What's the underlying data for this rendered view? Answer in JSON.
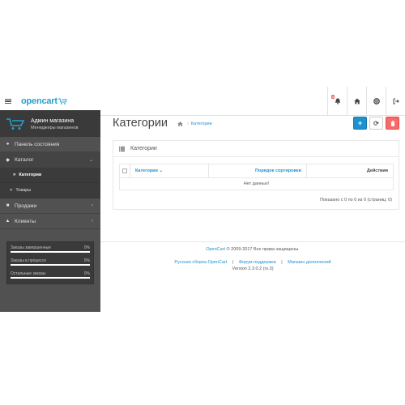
{
  "header": {
    "logo_text": "opencart",
    "notification_count": "5",
    "icons": [
      "menu-icon",
      "bell-icon",
      "home-icon",
      "life-ring-icon",
      "sign-out-icon"
    ]
  },
  "sidebar": {
    "profile_name": "Админ магазина",
    "profile_role": "Менеджеры магазинов",
    "items": [
      {
        "label": "Панель состояния",
        "icon": "dashboard-icon"
      },
      {
        "label": "Каталог",
        "icon": "tag-icon"
      },
      {
        "label": "Категории"
      },
      {
        "label": "Товары"
      },
      {
        "label": "Продажи",
        "icon": "cart-icon"
      },
      {
        "label": "Клиенты",
        "icon": "user-icon"
      }
    ],
    "stats": [
      {
        "label": "Заказы завершенные",
        "value": "0%"
      },
      {
        "label": "Заказы в процессе",
        "value": "0%"
      },
      {
        "label": "Остальные заказы",
        "value": "0%"
      }
    ]
  },
  "main": {
    "title": "Категории",
    "breadcrumb": "Категории",
    "panel_title": "Категории",
    "columns": {
      "name": "Категории",
      "sort": "Порядок сортировки",
      "action": "Действия"
    },
    "empty": "Нет данных!",
    "pagination": "Показано с 0 по 0 из 0 (страниц: 0)"
  },
  "footer": {
    "brand": "OpenCart",
    "copyright": "© 2009-2017 Все права защищены.",
    "links": [
      "Русская сборка OpenCart",
      "Форум поддержки",
      "Магазин дополнений"
    ],
    "sep": "|",
    "version": "Version 2.3.0.2 (rs.3)"
  },
  "colors": {
    "accent": "#1e91cf",
    "danger": "#f56b6b",
    "sidebar": "#515151"
  }
}
